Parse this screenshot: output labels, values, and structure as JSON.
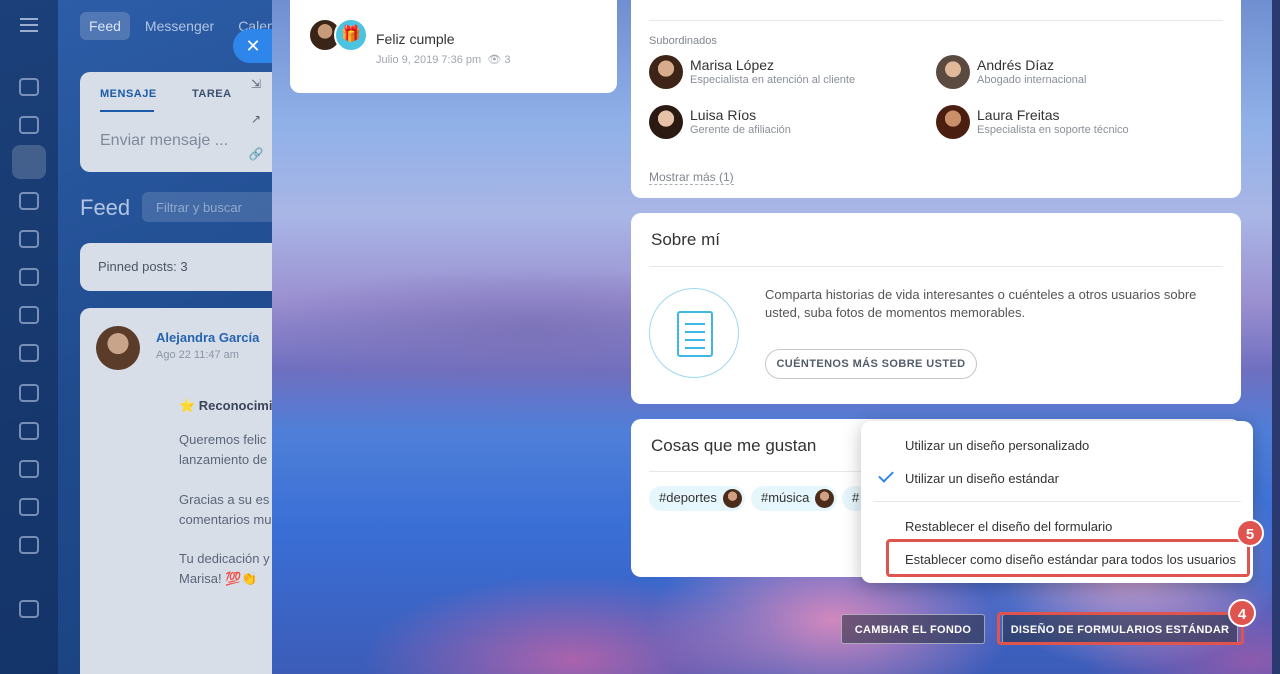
{
  "topbar": {
    "tabs": [
      "Feed",
      "Messenger",
      "Calen"
    ]
  },
  "composer": {
    "tab_message": "MENSAJE",
    "tab_task": "TAREA",
    "placeholder": "Enviar mensaje ..."
  },
  "feed": {
    "title": "Feed",
    "filter_placeholder": "Filtrar y buscar",
    "pinned": "Pinned posts: 3",
    "post": {
      "author": "Alejandra García",
      "date": "Ago 22 11:47 am",
      "lines": [
        "⭐ Reconocimi",
        "Queremos felic",
        "lanzamiento de",
        "Gracias a su es",
        "comentarios mu",
        "Tu dedicación y",
        "Marisa! 💯👏"
      ]
    }
  },
  "birthday": {
    "title": "Feliz cumple",
    "meta": "Julio 9, 2019 7:36 pm",
    "views": "3"
  },
  "subordinates": {
    "label": "Subordinados",
    "people": [
      {
        "name": "Marisa López",
        "role": "Especialista en atención al cliente"
      },
      {
        "name": "Andrés Díaz",
        "role": "Abogado internacional"
      },
      {
        "name": "Luisa Ríos",
        "role": "Gerente de afiliación"
      },
      {
        "name": "Laura Freitas",
        "role": "Especialista en soporte técnico"
      }
    ],
    "show_more": "Mostrar más (1)"
  },
  "about": {
    "title": "Sobre mí",
    "text": "Comparta historias de vida interesantes o cuénteles a otros usuarios sobre usted, suba fotos de momentos memorables.",
    "button": "CUÉNTENOS MÁS SOBRE USTED"
  },
  "interests": {
    "title": "Cosas que me gustan",
    "tags": [
      "#deportes",
      "#música",
      "#"
    ]
  },
  "menu": {
    "items": [
      "Utilizar un diseño personalizado",
      "Utilizar un diseño estándar",
      "Restablecer el diseño del formulario",
      "Establecer como diseño estándar para todos los usuarios"
    ],
    "checked_index": 1
  },
  "steps": {
    "menu_step": "5",
    "button_step": "4"
  },
  "buttons": {
    "change_background": "CAMBIAR EL FONDO",
    "standard_layout": "DISEÑO DE FORMULARIOS ESTÁNDAR"
  },
  "colors": {
    "accent": "#2f86ea",
    "highlight": "#e0544f",
    "tag_bg": "#e5f6fc"
  }
}
